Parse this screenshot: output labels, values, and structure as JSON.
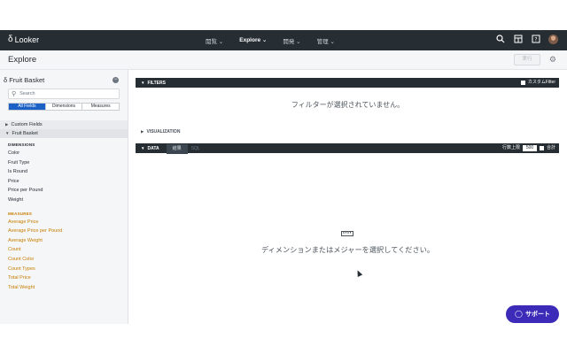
{
  "topnav": {
    "logo_text": "Looker",
    "menu": [
      "閲覧 ⌄",
      "Explore ⌄",
      "開発 ⌄",
      "管理 ⌄"
    ],
    "active_menu_index": 1,
    "icons": [
      "search-icon",
      "browse-icon",
      "help-icon",
      "avatar"
    ]
  },
  "header": {
    "title": "Explore",
    "run_label": "実行"
  },
  "sidebar": {
    "model_name": "Fruit Basket",
    "search_placeholder": "Search",
    "tabs": [
      "All Fields",
      "Dimensions",
      "Measures"
    ],
    "active_tab": "All Fields",
    "groups": [
      "Custom Fields",
      "Fruit Basket"
    ],
    "dimensions_label": "DIMENSIONS",
    "dimensions": [
      "Color",
      "Fruit Type",
      "Is Round",
      "Price",
      "Price per Pound",
      "Weight"
    ],
    "measures_label": "MEASURES",
    "measures": [
      "Average Price",
      "Average Price per Pound",
      "Average Weight",
      "Count",
      "Count Color",
      "Count Types",
      "Total Price",
      "Total Weight"
    ]
  },
  "main": {
    "filters_label": "FILTERS",
    "custom_filter_label": "カスタムFilter",
    "no_filters_text": "フィルターが選択されていません。",
    "visualization_label": "VISUALIZATION",
    "data_label": "DATA",
    "results_tab": "結果",
    "sql_tab": "SQL",
    "row_limit_label": "行数上限",
    "row_limit_value": "500",
    "totals_label": "合計",
    "empty_message": "ディメンションまたはメジャーを選択してください。",
    "support_label": "サポート"
  },
  "colors": {
    "nav_bg": "#262d33",
    "measure_text": "#c67d00",
    "active_tab": "#1c61c5",
    "support_button": "#3b2bb8"
  }
}
